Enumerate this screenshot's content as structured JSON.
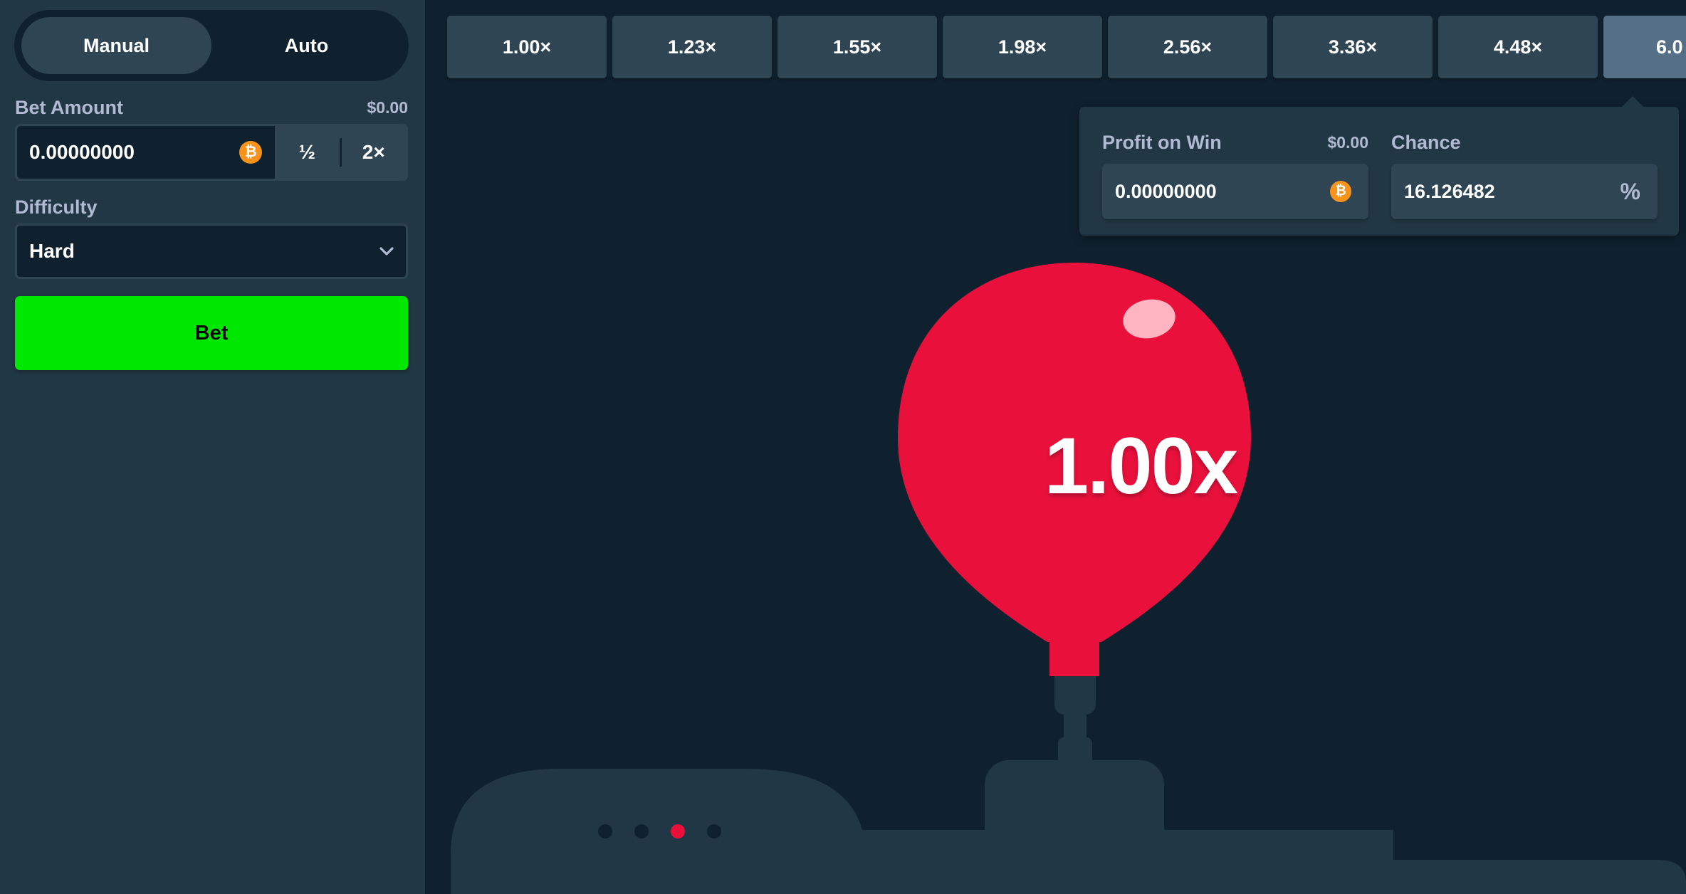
{
  "sidebar": {
    "mode_tabs": [
      {
        "label": "Manual",
        "active": true
      },
      {
        "label": "Auto",
        "active": false
      }
    ],
    "bet_amount": {
      "label": "Bet Amount",
      "usd_value": "$0.00",
      "value": "0.00000000",
      "currency_icon": "bitcoin-icon",
      "half_label": "½",
      "double_label": "2×"
    },
    "difficulty": {
      "label": "Difficulty",
      "selected": "Hard"
    },
    "bet_button_label": "Bet"
  },
  "multipliers": [
    "1.00×",
    "1.23×",
    "1.55×",
    "1.98×",
    "2.56×",
    "3.36×",
    "4.48×",
    "6.0"
  ],
  "active_multiplier_index": 7,
  "info_panel": {
    "profit_on_win": {
      "label": "Profit on Win",
      "usd_value": "$0.00",
      "value": "0.00000000",
      "currency_icon": "bitcoin-icon"
    },
    "chance": {
      "label": "Chance",
      "value": "16.126482",
      "unit": "%"
    }
  },
  "balloon": {
    "multiplier": "1.00x",
    "color": "#e9113c"
  },
  "pump_indicator": {
    "dot_count": 4,
    "active_dot_index": 2
  },
  "colors": {
    "background": "#0f212e",
    "sidebar": "#213743",
    "chip": "#2f4553",
    "accent_green": "#00e701",
    "balloon_red": "#e9113c",
    "bitcoin_orange": "#f7931a"
  }
}
